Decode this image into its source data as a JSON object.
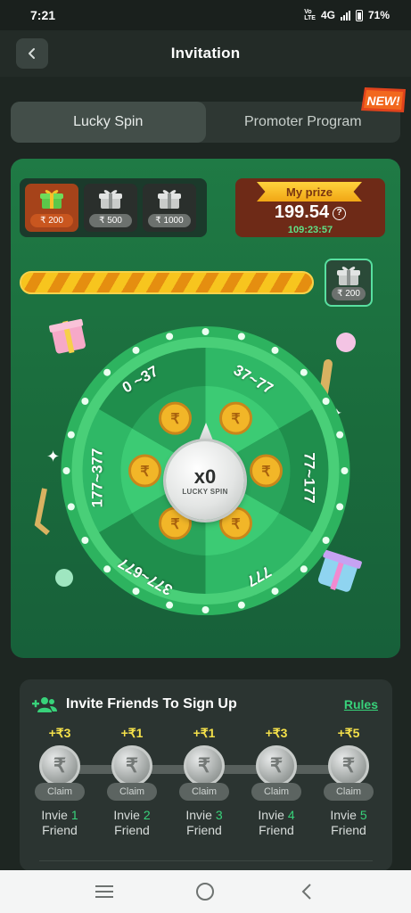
{
  "status_bar": {
    "time": "7:21",
    "network": "4G",
    "battery": "71%"
  },
  "header": {
    "title": "Invitation"
  },
  "tabs": [
    {
      "label": "Lucky Spin",
      "active": true
    },
    {
      "label": "Promoter Program",
      "active": false
    }
  ],
  "new_badge": "NEW!",
  "tiers": [
    {
      "amount": "₹ 200",
      "active": true
    },
    {
      "amount": "₹ 500",
      "active": false
    },
    {
      "amount": "₹ 1000",
      "active": false
    }
  ],
  "prize": {
    "title": "My prize",
    "value": "199.54",
    "help": "?",
    "timer": "109:23:57"
  },
  "progress": {
    "fraction": 1.0,
    "gift_amount": "₹ 200"
  },
  "wheel": {
    "segments": [
      "37~77",
      "77~177",
      "777",
      "377~677",
      "177~377",
      "0 ~37"
    ],
    "spin_count": "x0",
    "spin_label": "LUCKY SPIN"
  },
  "invite": {
    "title": "Invite Friends To Sign Up",
    "rules_label": "Rules",
    "steps": [
      {
        "reward": "+₹3",
        "claim": "Claim",
        "text_a": "Invie",
        "num": "1",
        "text_b": "Friend"
      },
      {
        "reward": "+₹1",
        "claim": "Claim",
        "text_a": "Invie",
        "num": "2",
        "text_b": "Friend"
      },
      {
        "reward": "+₹1",
        "claim": "Claim",
        "text_a": "Invie",
        "num": "3",
        "text_b": "Friend"
      },
      {
        "reward": "+₹3",
        "claim": "Claim",
        "text_a": "Invie",
        "num": "4",
        "text_b": "Friend"
      },
      {
        "reward": "+₹5",
        "claim": "Claim",
        "text_a": "Invie",
        "num": "5",
        "text_b": "Friend"
      }
    ]
  },
  "colors": {
    "accent_green": "#38d27a",
    "wheel_green": "#2fb866",
    "gold": "#f4e04a"
  }
}
